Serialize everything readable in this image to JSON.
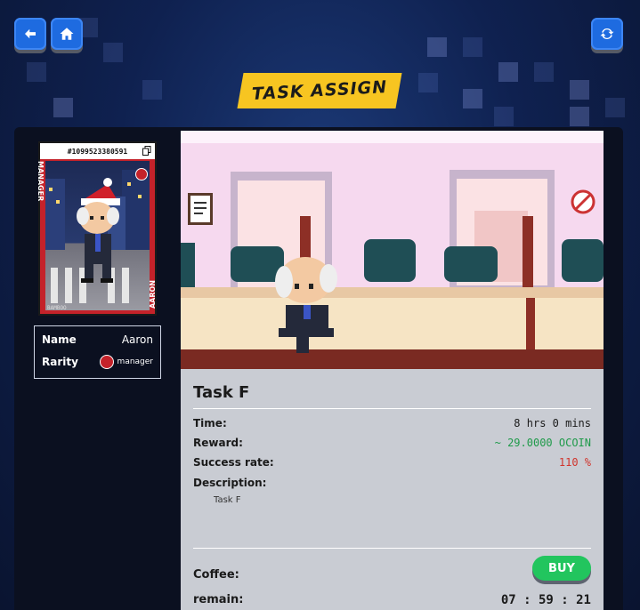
{
  "nav": {
    "back_icon": "arrow-left-icon",
    "home_icon": "home-icon",
    "refresh_icon": "refresh-icon"
  },
  "banner": {
    "title": "TASK ASSIGN"
  },
  "card": {
    "id": "#1099523380591",
    "role": "MANAGER",
    "name": "AARON",
    "footer": "BAMBOO"
  },
  "character": {
    "name_label": "Name",
    "name_value": "Aaron",
    "rarity_label": "Rarity",
    "rarity_value": "manager"
  },
  "task": {
    "title": "Task F",
    "time_label": "Time:",
    "time_value": "8 hrs 0 mins",
    "reward_label": "Reward:",
    "reward_value": "~ 29.0000 OCOIN",
    "success_label": "Success rate:",
    "success_value": "110 %",
    "description_label": "Description:",
    "description_value": "Task F",
    "coffee_label": "Coffee:",
    "buy_label": "BUY",
    "remain_label": "remain:",
    "remain_value": "07 : 59 : 21"
  },
  "colors": {
    "reward": "#1f9a4a",
    "success": "#d0342c",
    "accent": "#1e6be0",
    "banner": "#f7c521",
    "buy": "#22c55e"
  }
}
